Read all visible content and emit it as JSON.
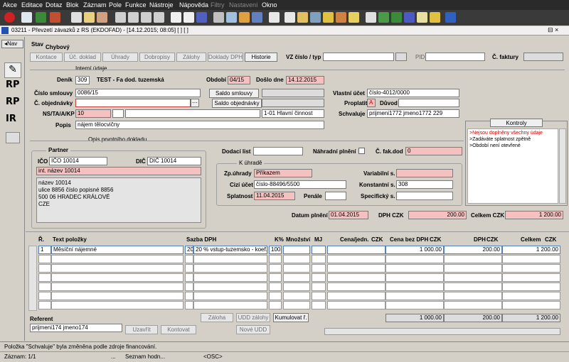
{
  "menu": [
    "Akce",
    "Editace",
    "Dotaz",
    "Blok",
    "Záznam",
    "Pole",
    "Funkce",
    "Nástroje",
    "Nápověda",
    "Filtry",
    "Nastavení",
    "Okno"
  ],
  "window": {
    "title": "03211 - Převzetí závazků z RS (EKDOFAD) - [14.12.2015; 08:05] [ ] [ ]",
    "controls": "⊟ ×"
  },
  "sidebar": {
    "nav": "Nav",
    "rp1": "RP",
    "rp2": "RP",
    "ir": "IR"
  },
  "status": {
    "label": "Stav",
    "value": "Chybový"
  },
  "tabs": [
    "Kontace",
    "Úč. doklad",
    "Úhrady",
    "Dobropisy",
    "Zálohy",
    "Doklady DPH",
    "Historie"
  ],
  "filters": {
    "vz_label": "VZ číslo / typ",
    "pid_label": "PID",
    "invoice_label": "Č. faktury"
  },
  "internal": {
    "section": "Interní údaje",
    "journal_label": "Deník",
    "journal": "309",
    "journal_name": "TEST - Fa dod. tuzemská",
    "period_label": "Období",
    "period": "04/15",
    "arrival_label": "Došlo dne",
    "arrival": "14.12.2015",
    "contract_label": "Číslo smlouvy",
    "contract": "0086/15",
    "order_label": "Č. objednávky",
    "order": "",
    "nst_label": "NS/TA/A/KP",
    "nst": "10",
    "activity": "1-01 Hlavní činnost",
    "desc_label": "Popis",
    "desc": "nájem tělocvičny",
    "saldo_contract": "Saldo smlouvy",
    "saldo_order": "Saldo objednávky",
    "account_label": "Vlastní účet",
    "account": "číslo-4012/0000",
    "pay_label": "Proplatit",
    "pay": "A",
    "reason_label": "Důvod",
    "approve_label": "Schvaluje",
    "approve": "prijmeni1772 jmeno1772 229"
  },
  "checks": {
    "title": "Kontroly",
    "items": [
      ">Nejsou doplněny všechny údaje",
      ">Zadáváte splatnost zpětně",
      ">Období není otevřené"
    ]
  },
  "source": {
    "section": "Opis prvotního dokladu",
    "partner": "Partner",
    "ico_label": "IČO",
    "ico": "IČO 10014",
    "dic_label": "DIČ",
    "dic": "DIČ 10014",
    "int_name": "int. název 10014",
    "address": [
      "název 10014",
      "ulice 8856 číslo popisné 8856",
      "500 06 HRADEC KRÁLOVÉ",
      "CZE"
    ],
    "delivery_label": "Dodací list",
    "replacement_label": "Náhradní plnění",
    "fak_label": "Č. fak.dod",
    "fak": "0",
    "pay_section": "K úhradě",
    "method_label": "Zp.úhrady",
    "method": "Příkazem",
    "foreign_label": "Cizí účet",
    "foreign": "číslo-88496/5500",
    "due_label": "Splatnost",
    "due": "11.04.2015",
    "penalty_label": "Penále",
    "var_label": "Variabilní s.",
    "const_label": "Konstantní s.",
    "const": "308",
    "spec_label": "Specifický s.",
    "perf_label": "Datum plnění",
    "perf": "01.04.2015",
    "vat_label": "DPH CZK",
    "vat": "200.00",
    "total_label": "Celkem CZK",
    "total": "1 200.00"
  },
  "grid": {
    "headers": {
      "r": "Ř.",
      "text": "Text položky",
      "rate": "Sazba DPH",
      "kp": "K%",
      "qty": "Množství",
      "mj": "MJ",
      "unit": "Cena/jedn.",
      "unit_cur": "CZK",
      "base": "Cena bez DPH",
      "base_cur": "CZK",
      "vat": "DPH",
      "vat_cur": "CZK",
      "total": "Celkem",
      "total_cur": "CZK"
    },
    "rows": [
      {
        "r": "1",
        "text": "Měsíční nájemné",
        "rate_code": "20",
        "rate": "20 % vstup-tuzemsko - koef.",
        "kp": "100",
        "qty": "",
        "mj": "",
        "unit": "",
        "base": "1 000.00",
        "vat": "200.00",
        "total": "1 200.00"
      }
    ],
    "sum": {
      "base": "1 000.00",
      "vat": "200.00",
      "total": "1 200.00"
    }
  },
  "bottom": {
    "referent_label": "Referent",
    "referent": "prijmeni174 jmeno174",
    "close": "Uzavřít",
    "check": "Kontovat",
    "advance": "Záloha",
    "udd": "UDD zálohy",
    "cumulate": "Kumulovat ř.",
    "new_udd": "Nové UDD"
  },
  "statusbar": {
    "message": "Položka \"Schvaluje\" byla změněna podle zdroje financování.",
    "record": "Záznam: 1/1",
    "dots": "...",
    "list": "Seznam hodn...",
    "osc": "<OSC>"
  }
}
